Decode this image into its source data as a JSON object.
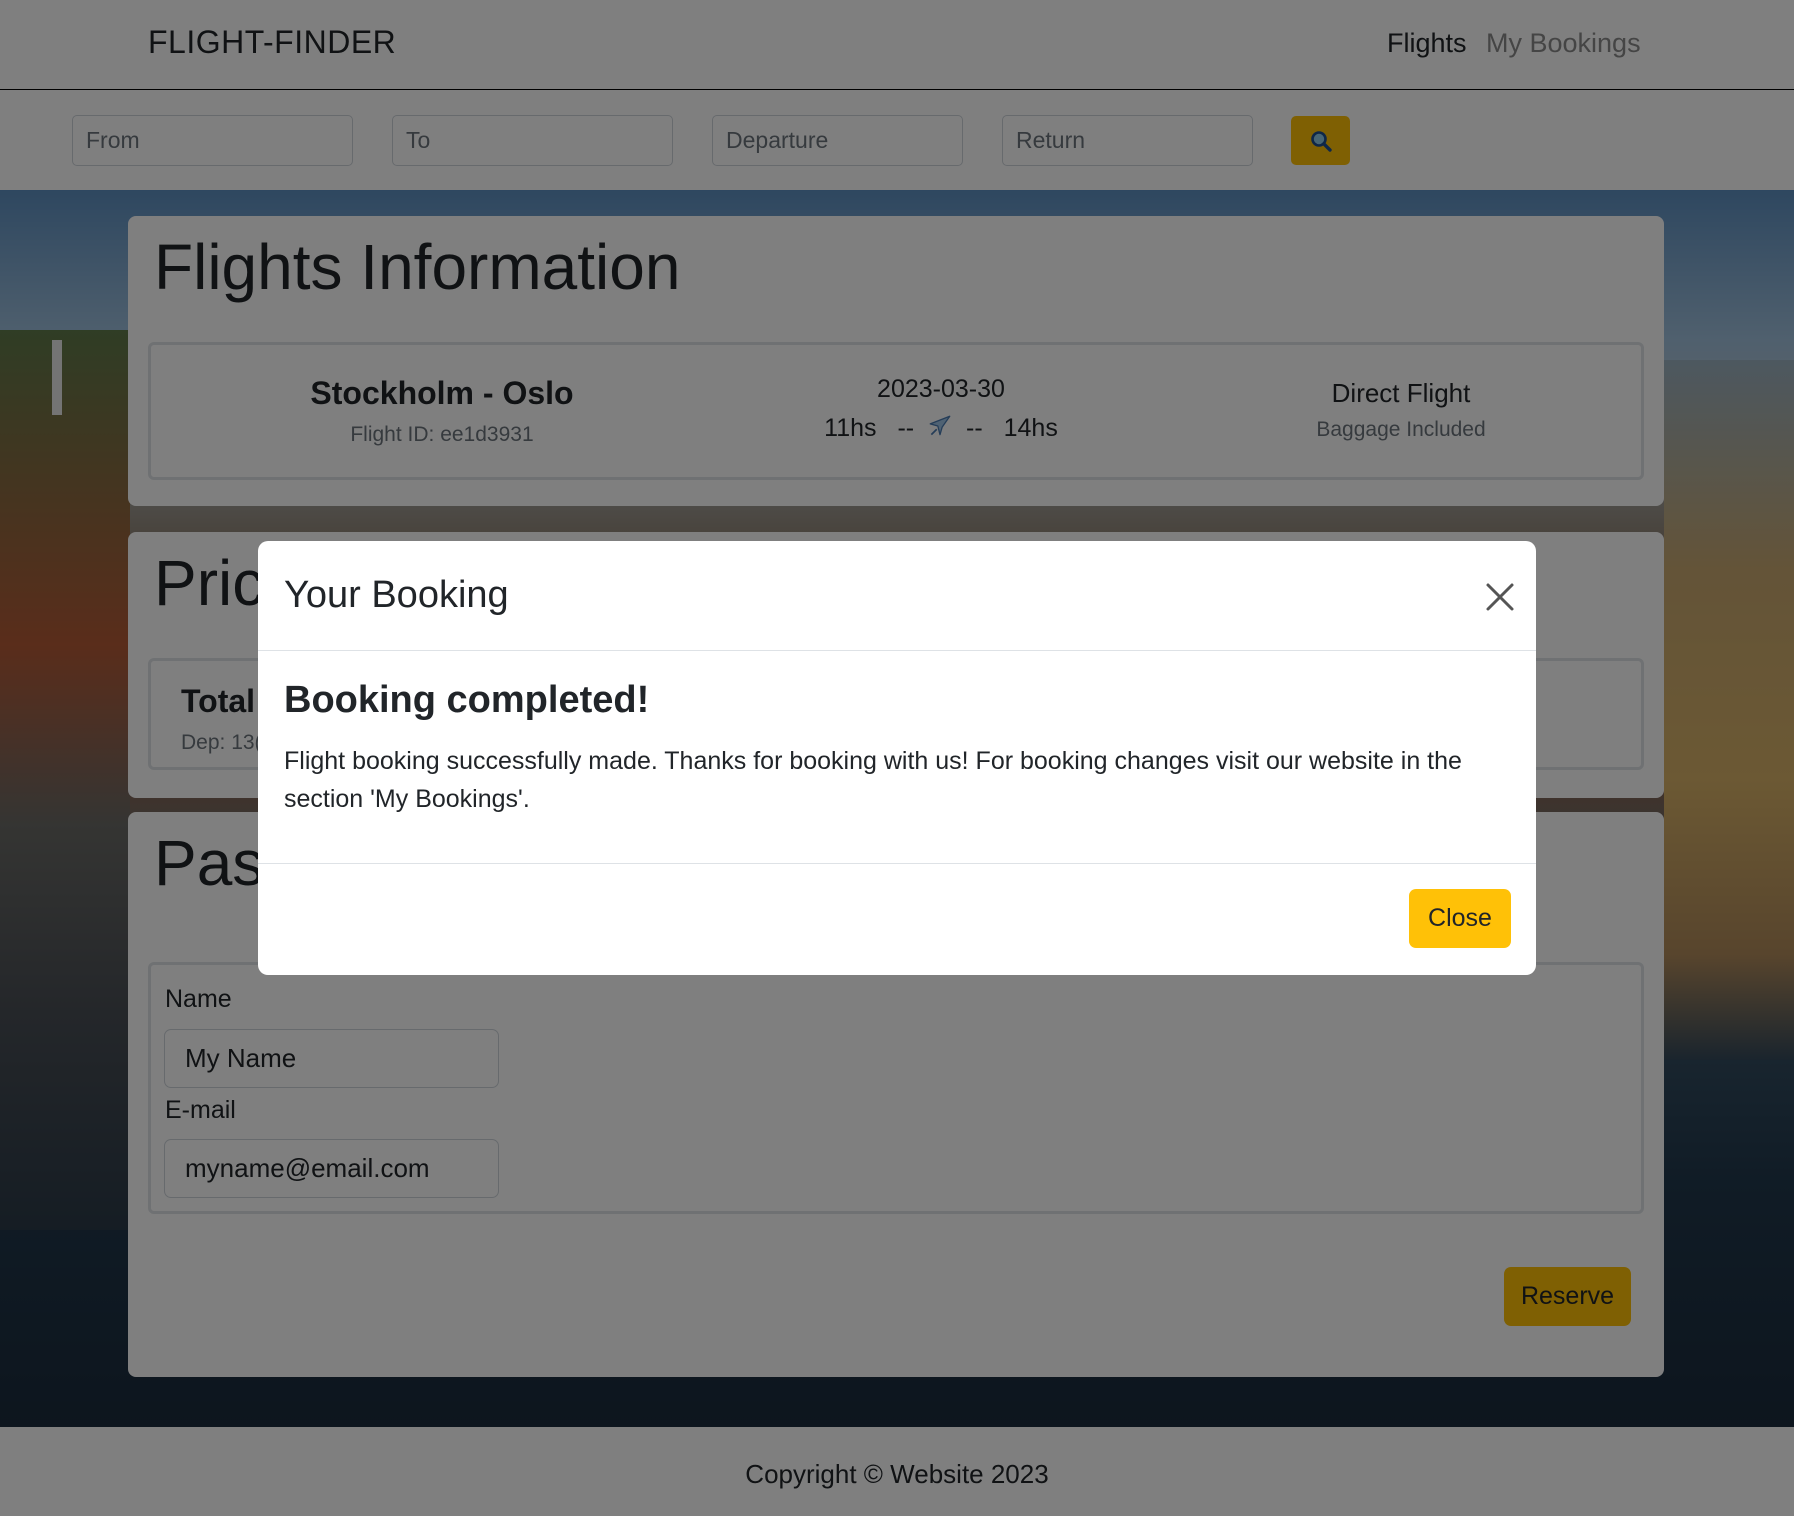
{
  "header": {
    "brand": "FLIGHT-FINDER",
    "nav": {
      "flights": "Flights",
      "my_bookings": "My Bookings"
    }
  },
  "search": {
    "from_placeholder": "From",
    "to_placeholder": "To",
    "departure_placeholder": "Departure",
    "return_placeholder": "Return",
    "button_icon": "search-icon"
  },
  "flights_info": {
    "title": "Flights Information",
    "route": "Stockholm - Oslo",
    "flight_id": "Flight ID: ee1d3931",
    "date": "2023-03-30",
    "departure_time": "11hs",
    "separator": "--",
    "arrival_time": "14hs",
    "plane_icon": "airplane-icon",
    "flight_type": "Direct Flight",
    "baggage": "Baggage Included"
  },
  "price": {
    "title_visible": "Pric",
    "total_visible": "Total",
    "dep_visible": "Dep: 13("
  },
  "passenger": {
    "title_visible": "Pass",
    "name_label": "Name",
    "name_value": "My Name",
    "email_label": "E-mail",
    "email_value": "myname@email.com",
    "reserve_label": "Reserve"
  },
  "footer": {
    "copyright": "Copyright © Website 2023"
  },
  "modal": {
    "title": "Your Booking",
    "heading": "Booking completed!",
    "message": "Flight booking successfully made. Thanks for booking with us! For booking changes visit our website in the section 'My Bookings'.",
    "close_label": "Close",
    "close_icon": "close-icon"
  },
  "colors": {
    "accent": "#ffc107",
    "backdrop": "rgba(0,0,0,0.5)",
    "muted": "#6c757d"
  }
}
